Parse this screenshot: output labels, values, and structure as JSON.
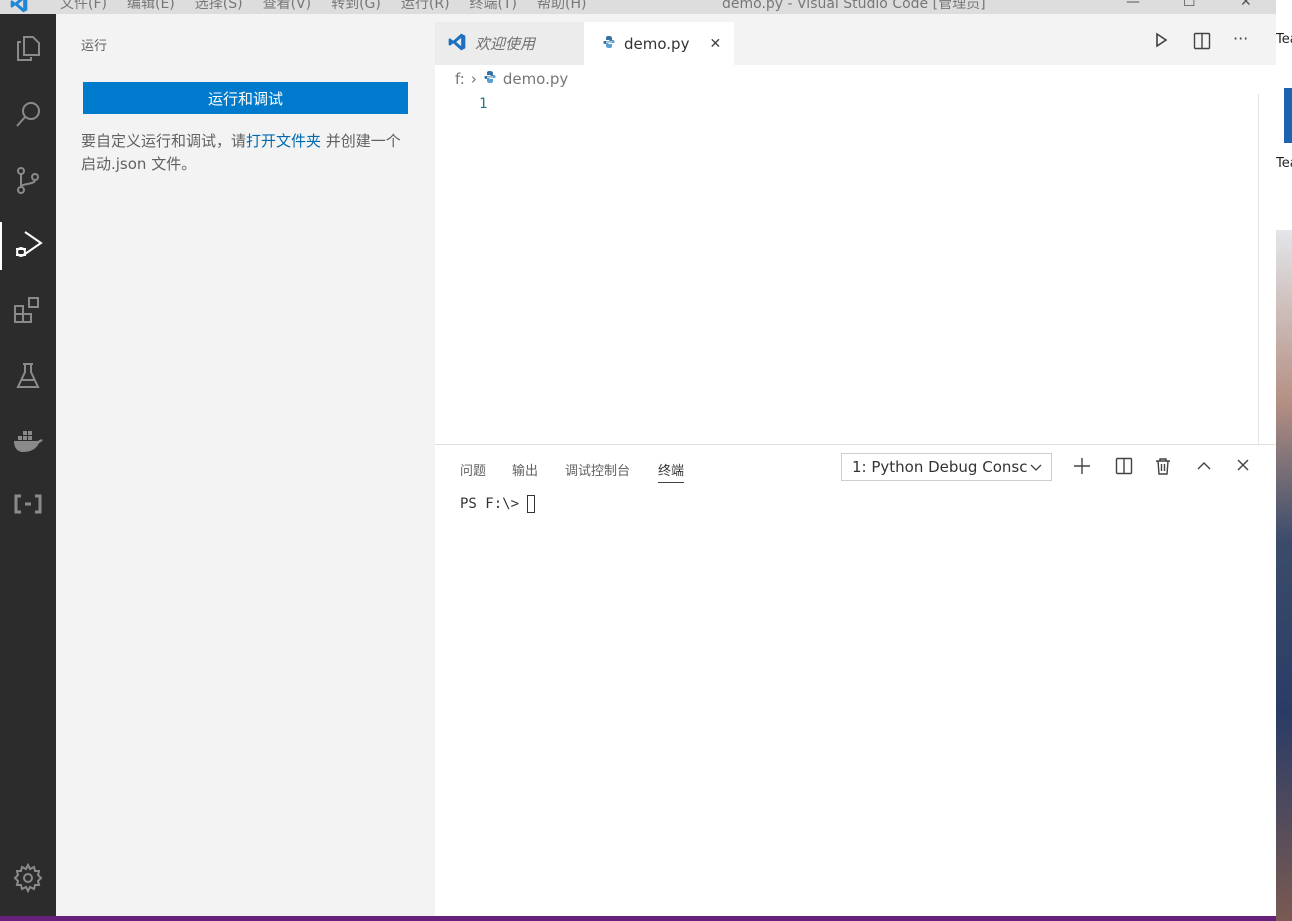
{
  "window": {
    "title": "demo.py - Visual Studio Code [管理员]",
    "menu": [
      "文件(F)",
      "编辑(E)",
      "选择(S)",
      "查看(V)",
      "转到(G)",
      "运行(R)",
      "终端(T)",
      "帮助(H)"
    ],
    "controls": {
      "minimize": "—",
      "maximize": "☐",
      "close": "✕"
    }
  },
  "activity_bar": {
    "items": [
      "files-icon",
      "search-icon",
      "source-control-icon",
      "run-debug-icon",
      "extensions-icon",
      "testing-icon",
      "docker-icon",
      "remote-icon"
    ],
    "active": "run-debug-icon",
    "bottom": "settings-gear-icon"
  },
  "sidebar": {
    "title": "运行",
    "run_button": "运行和调试",
    "desc_before": "要自定义运行和调试，请",
    "desc_link": "打开文件夹",
    "desc_after": " 并创建一个启动.json 文件。"
  },
  "editor": {
    "tabs": [
      {
        "label": "欢迎使用",
        "icon": "vscode-icon",
        "italic": true
      },
      {
        "label": "demo.py",
        "icon": "python-icon",
        "close": "✕",
        "active": true
      }
    ],
    "breadcrumb": {
      "drive": "f:",
      "separator": "›",
      "file": "demo.py"
    },
    "line_numbers": [
      "1"
    ],
    "actions": [
      "run-icon",
      "split-editor-icon",
      "more-actions-icon"
    ]
  },
  "panel": {
    "tabs": [
      "问题",
      "输出",
      "调试控制台",
      "终端"
    ],
    "active_tab": "终端",
    "terminal_select": "1: Python Debug Consc",
    "actions": [
      "plus-icon",
      "split-terminal-icon",
      "trash-icon",
      "chevron-up-icon",
      "close-icon"
    ],
    "prompt": "PS F:\\>"
  },
  "desktop": {
    "label_top": "Tea",
    "label_mid": "Tea"
  },
  "colors": {
    "accent": "#007acc",
    "activity_bg": "#2c2c2c",
    "sidebar_bg": "#f3f3f3",
    "link": "#006ab1",
    "line_number": "#237893",
    "status_strip": "#68217a"
  }
}
